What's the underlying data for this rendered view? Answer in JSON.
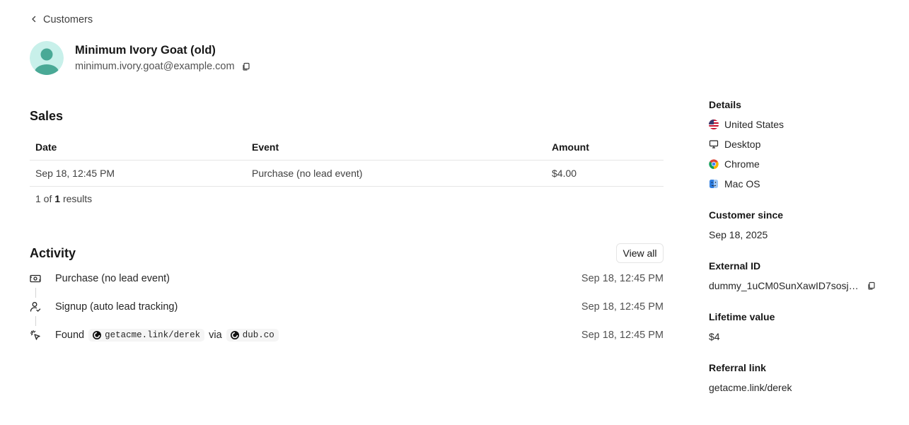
{
  "nav": {
    "back_label": "Customers"
  },
  "customer": {
    "name": "Minimum Ivory Goat (old)",
    "email": "minimum.ivory.goat@example.com"
  },
  "sales": {
    "title": "Sales",
    "columns": [
      "Date",
      "Event",
      "Amount"
    ],
    "rows": [
      {
        "date": "Sep 18, 12:45 PM",
        "event": "Purchase (no lead event)",
        "amount": "$4.00"
      }
    ],
    "results_prefix": "1 of",
    "results_count": "1",
    "results_suffix": "results"
  },
  "activity": {
    "title": "Activity",
    "view_all_label": "View all",
    "items": [
      {
        "icon": "money-icon",
        "text": "Purchase (no lead event)",
        "time": "Sep 18, 12:45 PM"
      },
      {
        "icon": "user-check-icon",
        "text": "Signup (auto lead tracking)",
        "time": "Sep 18, 12:45 PM"
      },
      {
        "icon": "cursor-rays-icon",
        "found_label": "Found",
        "link": "getacme.link/derek",
        "via_label": "via",
        "domain": "dub.co",
        "time": "Sep 18, 12:45 PM"
      }
    ]
  },
  "details": {
    "label": "Details",
    "country": "United States",
    "device": "Desktop",
    "browser": "Chrome",
    "os": "Mac OS",
    "customer_since_label": "Customer since",
    "customer_since": "Sep 18, 2025",
    "external_id_label": "External ID",
    "external_id": "dummy_1uCM0SunXawID7sosjl...",
    "lifetime_value_label": "Lifetime value",
    "lifetime_value": "$4",
    "referral_link_label": "Referral link",
    "referral_link": "getacme.link/derek"
  },
  "colors": {
    "avatar_bg": "#c8f0ea",
    "avatar_figure": "#4aa996",
    "border": "#e5e5e5"
  }
}
